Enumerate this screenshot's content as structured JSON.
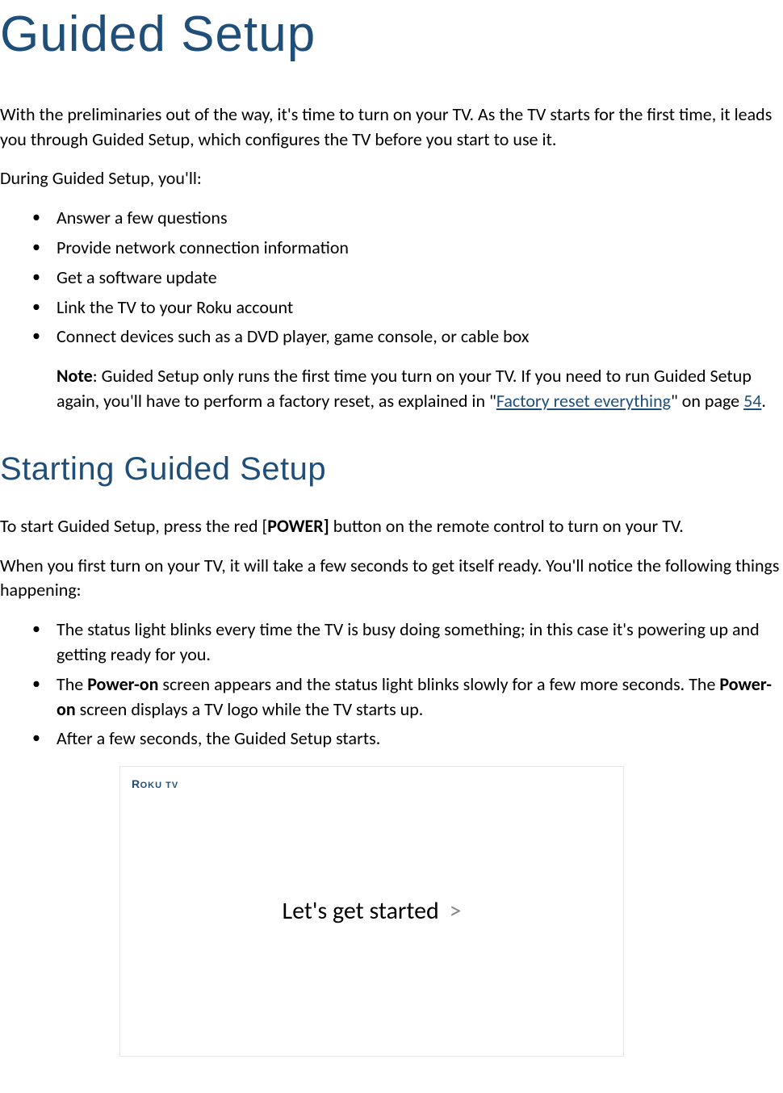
{
  "title": "Guided Setup",
  "intro_p1": "With the preliminaries out of the way, it's time to turn on your TV. As the TV starts for the first time, it leads you through Guided Setup, which configures the TV before you start to use it.",
  "intro_p2": "During Guided Setup, you'll:",
  "bullets1": [
    "Answer a few questions",
    "Provide network connection information",
    "Get a software update",
    "Link the TV to your Roku account",
    "Connect devices such as a DVD player, game console, or cable box"
  ],
  "note": {
    "label": "Note",
    "text1": ": Guided Setup only runs the first time you turn on your TV. If you need to run Guided Setup again, you'll have to perform a factory reset, as explained in \"",
    "link1": "Factory reset everything",
    "text2": "\" on page ",
    "link2": "54",
    "text3": "."
  },
  "section2_title": "Starting Guided Setup",
  "section2_p1_a": "To start Guided Setup, press the red [",
  "section2_p1_bold": "POWER]",
  "section2_p1_b": " button on the remote control to turn on your TV.",
  "section2_p2": "When you first turn on your TV, it will take a few seconds to get itself ready. You'll notice the following things happening:",
  "bullets2": {
    "item1": "The status light blinks every time the TV is busy doing something; in this case it's powering up and getting ready for you.",
    "item2_a": "The ",
    "item2_bold1": "Power-on",
    "item2_b": " screen appears and the status light blinks slowly for a few more seconds. The ",
    "item2_bold2": "Power-on",
    "item2_c": " screen displays a TV logo while the TV starts up.",
    "item3": "After a few seconds, the Guided Setup starts."
  },
  "screenshot": {
    "logo_r": "R",
    "logo_rest": "OKU TV",
    "main_text": "Let's get started ",
    "chevron": ">"
  }
}
